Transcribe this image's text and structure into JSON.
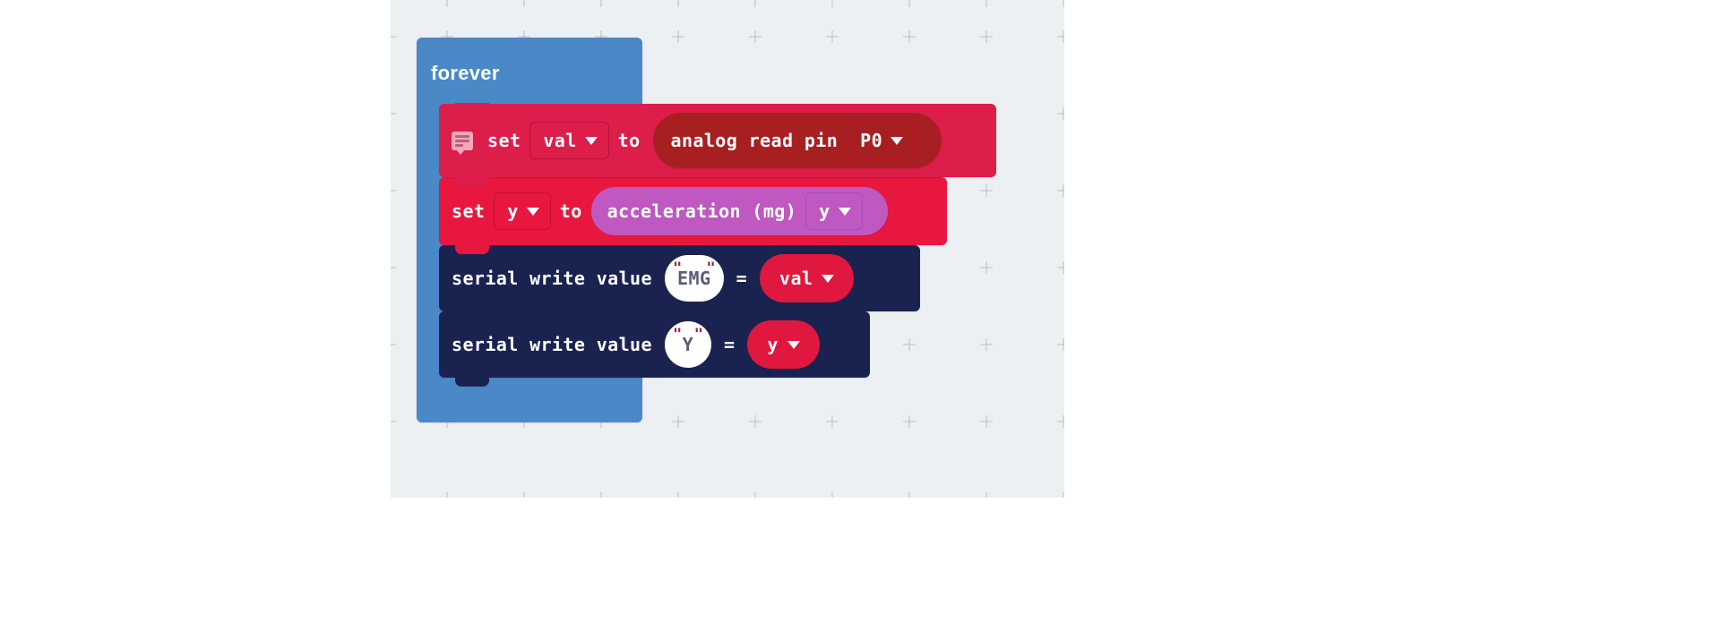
{
  "workspace": {
    "background_color": "#ecf0f2",
    "page_background": "#ffffff",
    "grid": "plus-marks"
  },
  "program": {
    "event_block": {
      "label": "forever",
      "color": "#4a88c7",
      "name": "forever-loop"
    },
    "statements": [
      {
        "kind": "variable-set",
        "color": "#dd1d4a",
        "has_comment_icon": true,
        "comment_icon": "comment-bubble-icon",
        "set_label": "set",
        "variable": "val",
        "to_label": "to",
        "value_block": {
          "kind": "analog-read-pin",
          "color": "#a81f22",
          "label": "analog read pin",
          "pin": "P0"
        }
      },
      {
        "kind": "variable-set",
        "color": "#e8173f",
        "has_comment_icon": false,
        "set_label": "set",
        "variable": "y",
        "to_label": "to",
        "value_block": {
          "kind": "acceleration",
          "color": "#bf58c0",
          "label": "acceleration (mg)",
          "axis": "y"
        }
      },
      {
        "kind": "serial-write-value",
        "color": "#1a2350",
        "label": "serial write value",
        "name_value": "EMG",
        "equals": "=",
        "value_block": {
          "kind": "variable-reporter",
          "color": "#e0173f",
          "variable": "val"
        }
      },
      {
        "kind": "serial-write-value",
        "color": "#1a2350",
        "label": "serial write value",
        "name_value": "Y",
        "equals": "=",
        "value_block": {
          "kind": "variable-reporter",
          "color": "#e0173f",
          "variable": "y"
        }
      }
    ]
  },
  "glyphs": {
    "quote": "\"",
    "caret": "▼"
  }
}
